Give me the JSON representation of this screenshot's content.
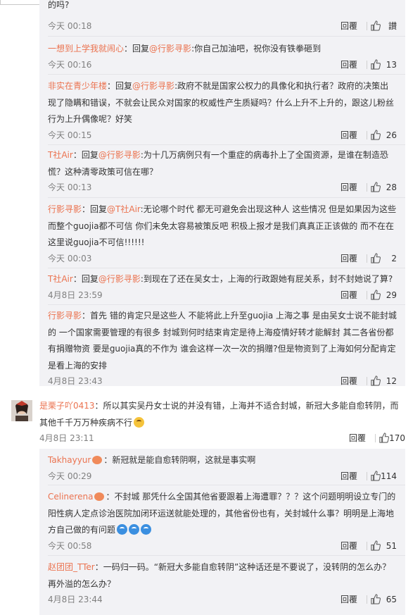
{
  "reply_label": "回覆",
  "top_fragment": "的吗?",
  "sub_comments_1": [
    {
      "user": "",
      "at": "",
      "text": "",
      "time": "今天 00:18",
      "likes": "讃"
    },
    {
      "user": "一想到上学我就闹心",
      "at": "@行影寻影",
      "text": ":你自己加油吧，祝你没有铁拳砸到",
      "time": "今天 00:16",
      "likes": "13"
    },
    {
      "user": "非实在青少年楼",
      "at": "@行影寻影",
      "text": ":政府不就是国家公权力的具像化和执行者？政府的决策出现了隐瞒和错误，不就会让民众对国家的权威性产生质疑吗？什么上升不上升的，跟这儿粉丝行为上升偶像呢？好笑",
      "time": "今天 00:15",
      "likes": "26"
    },
    {
      "user": "T社Air",
      "at": "@行影寻影",
      "text": ":为十几万病例只有一个重症的病毒扑上了全国资源，是谁在制造恐慌？这种清零政策可信在哪？",
      "time": "今天 00:13",
      "likes": "28"
    },
    {
      "user": "行影寻影",
      "at": "@T社Air",
      "text": ":无论哪个时代 都无可避免会出现这种人 这些情况 但是如果因为这些而整个guojia都不可信 你们未免太容易被策反吧 积极上报才是我们真真正正该做的 而不在在这里说guojia不可信!!!!!!",
      "time": "今天 00:03",
      "likes": "2"
    },
    {
      "user": "T社Air",
      "at": "@行影寻影",
      "text": ":到现在了还在吴女士，上海的行政跟她有屁关系，封不封她说了算?",
      "time": "4月8日 23:59",
      "likes": "29"
    },
    {
      "user": "行影寻影",
      "at": "",
      "text": "：首先 错的肯定只是这些人 不能将此上升至guojia 上海之事 是由吴女士说不能封城的 一个国家需要管理的有很多 封城到何时结束肯定是待上海疫情好转才能解封 其二各省份都有捐赠物资 要是guojia真的不作为 谁会这样一次一次的捐赠?但是物资到了上海如何分配肯定是看上海的安排",
      "time": "4月8日 23:43",
      "likes": "12"
    }
  ],
  "main_comment": {
    "user": "是栗子吖0413",
    "text": "：所以其实吴丹女士说的并没有错，上海并不适合封城，新冠大多能自愈转阴，而其他千千万万种疾病不行",
    "time": "4月8日 23:11",
    "likes": "170"
  },
  "sub_comments_2": [
    {
      "user": "Takhayyur",
      "text": "：新冠就是能自愈转阴啊，这就是事实啊",
      "time": "今天 00:29",
      "likes": "114"
    },
    {
      "user": "Celinerena",
      "text": "：不封城 那凭什么全国其他省要跟着上海遭罪？？？这个问题明明设立专门的阳性病人定点诊治医院加闭环运送就能处理的，其他省份也有，关封城什么事？明明是上海地方自己做的有问题",
      "time": "今天 00:58",
      "likes": "51"
    },
    {
      "user": "赵团团_TTer",
      "text": "：一码归一码。“新冠大多能自愈转阴”这种话还是不要说了，没转阴的怎么办？再外溢的怎么办？",
      "time": "4月8日 23:44",
      "likes": "65"
    }
  ],
  "reply_word": "回复"
}
